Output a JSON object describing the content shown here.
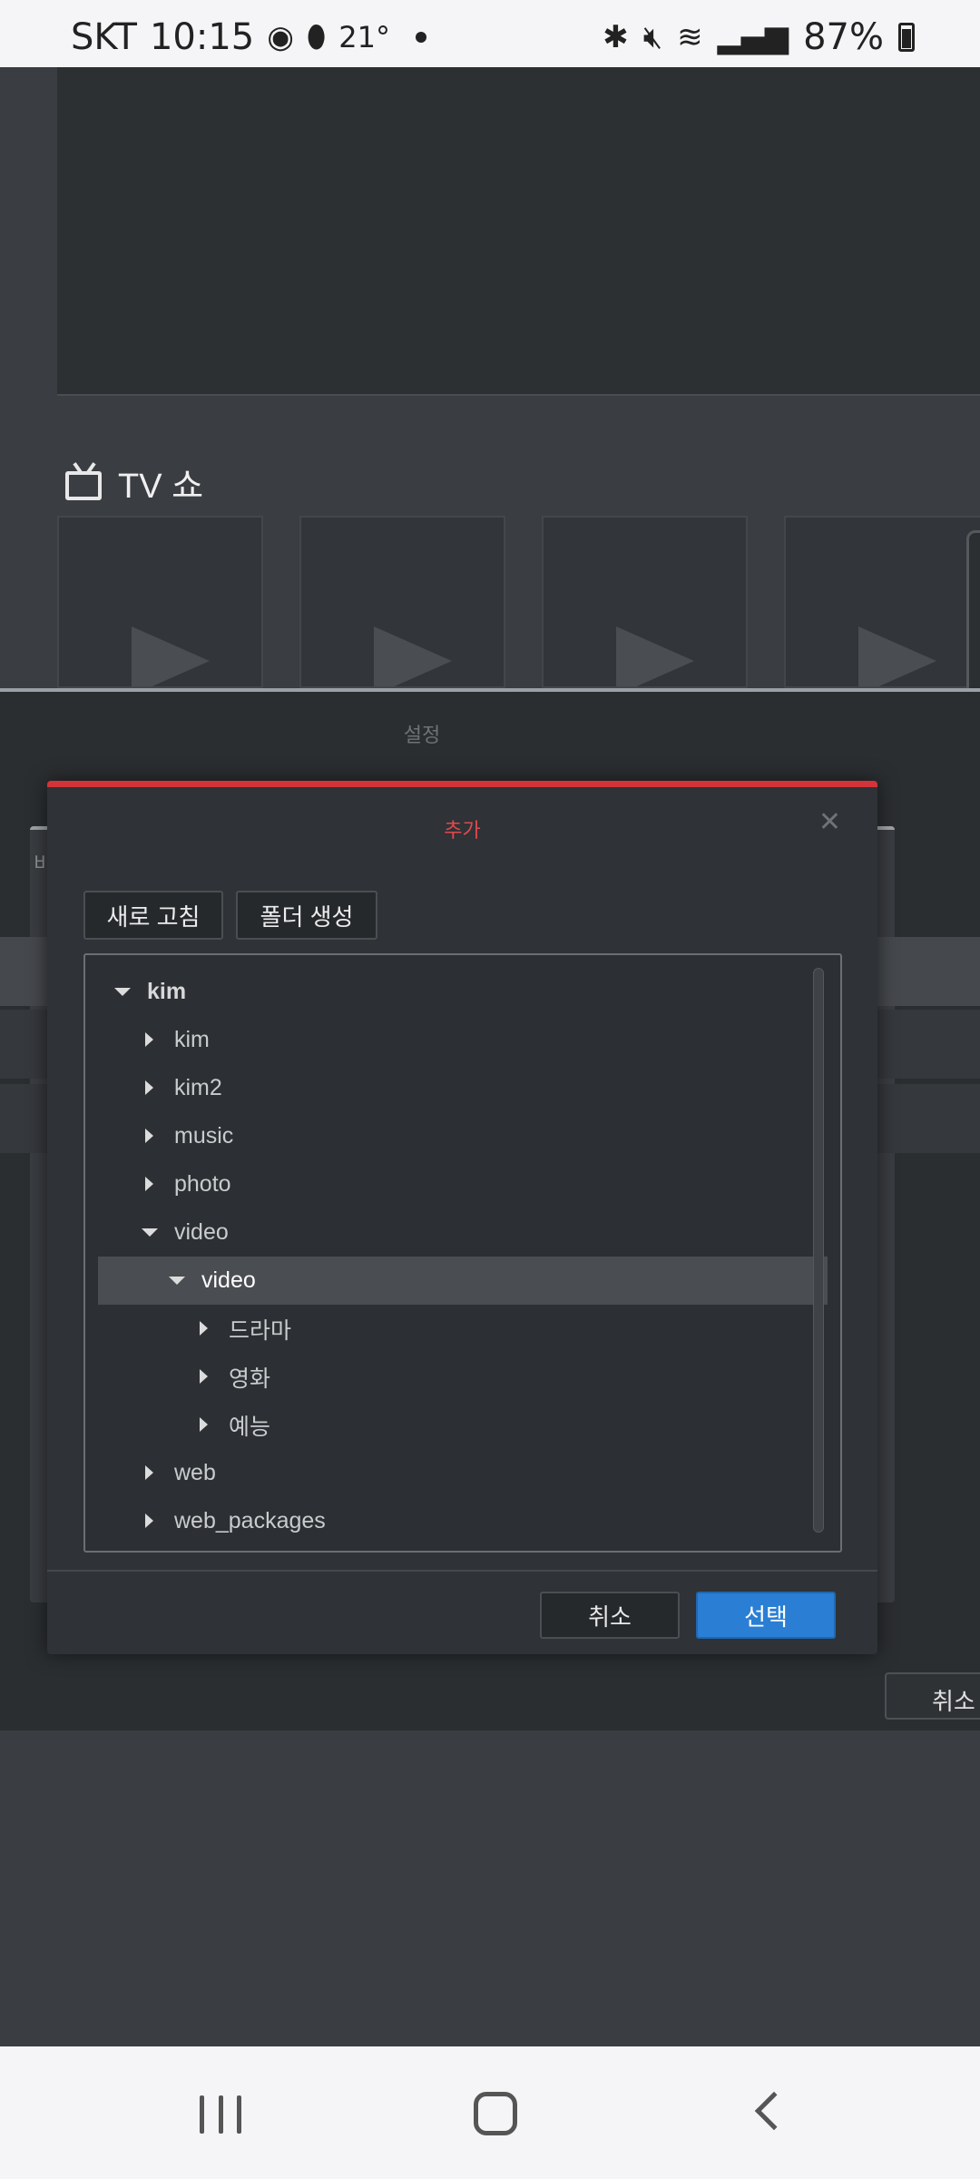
{
  "status_bar": {
    "carrier": "SKT",
    "time": "10:15",
    "temperature": "21°",
    "battery": "87%"
  },
  "background": {
    "section_title": "TV 쇼",
    "settings_title": "설정",
    "settings_partial_label": "비",
    "settings_cancel": "취소"
  },
  "dialog": {
    "title": "추가",
    "refresh_label": "새로 고침",
    "new_folder_label": "폴더 생성",
    "cancel_label": "취소",
    "select_label": "선택",
    "tree": [
      {
        "label": "kim",
        "depth": 0,
        "expanded": true
      },
      {
        "label": "kim",
        "depth": 1,
        "expanded": false
      },
      {
        "label": "kim2",
        "depth": 1,
        "expanded": false
      },
      {
        "label": "music",
        "depth": 1,
        "expanded": false
      },
      {
        "label": "photo",
        "depth": 1,
        "expanded": false
      },
      {
        "label": "video",
        "depth": 1,
        "expanded": true
      },
      {
        "label": "video",
        "depth": 2,
        "expanded": true,
        "selected": true
      },
      {
        "label": "드라마",
        "depth": 3,
        "expanded": false
      },
      {
        "label": "영화",
        "depth": 3,
        "expanded": false
      },
      {
        "label": "예능",
        "depth": 3,
        "expanded": false
      },
      {
        "label": "web",
        "depth": 1,
        "expanded": false
      },
      {
        "label": "web_packages",
        "depth": 1,
        "expanded": false
      }
    ]
  },
  "colors": {
    "dialog_accent": "#d3343a",
    "select_button": "#2a7fd4"
  }
}
